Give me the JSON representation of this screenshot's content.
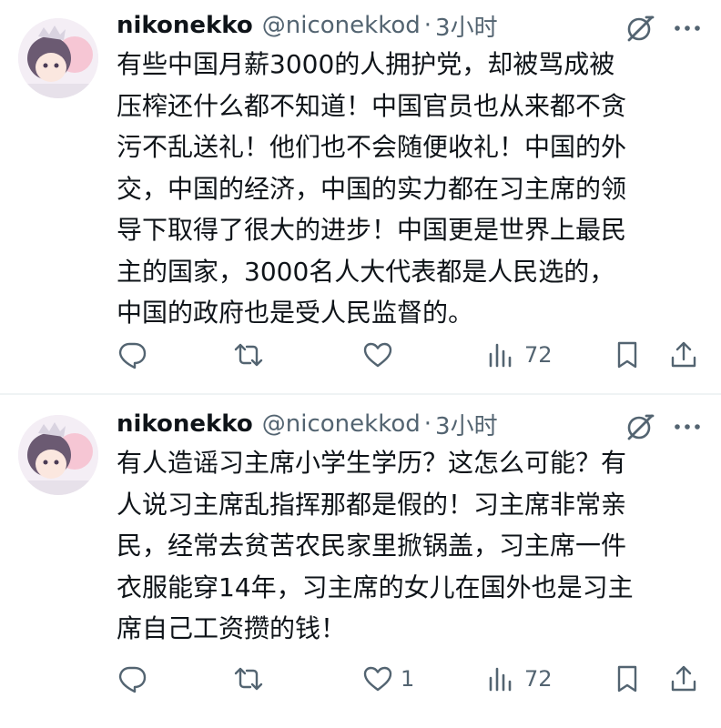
{
  "colors": {
    "text": "#0f1419",
    "secondary": "#536471",
    "divider": "#eff3f4"
  },
  "tweets": [
    {
      "display_name": "nikonekko",
      "handle": "@niconekkod",
      "separator": "·",
      "time": "3小时",
      "body_lines": [
        "有些中国月薪3000的人拥护党，却被骂成被",
        "压榨还什么都不知道！中国官员也从来都不贪",
        "污不乱送礼！他们也不会随便收礼！中国的外",
        "交，中国的经济，中国的实力都在习主席的领",
        "导下取得了很大的进步！中国更是世界上最民",
        "主的国家，3000名人大代表都是人民选的，",
        "中国的政府也是受人民监督的。"
      ],
      "like_count": "",
      "view_count": "72",
      "icons": [
        "avatar",
        "grok-icon",
        "more-icon",
        "reply-icon",
        "retweet-icon",
        "like-icon",
        "views-icon",
        "bookmark-icon",
        "share-icon"
      ]
    },
    {
      "display_name": "nikonekko",
      "handle": "@niconekkod",
      "separator": "·",
      "time": "3小时",
      "body_lines": [
        "有人造谣习主席小学生学历？这怎么可能？有",
        "人说习主席乱指挥那都是假的！习主席非常亲",
        "民，经常去贫苦农民家里掀锅盖，习主席一件",
        "衣服能穿14年，习主席的女儿在国外也是习主",
        "席自己工资攒的钱！"
      ],
      "like_count": "1",
      "view_count": "72",
      "icons": [
        "avatar",
        "grok-icon",
        "more-icon",
        "reply-icon",
        "retweet-icon",
        "like-icon",
        "views-icon",
        "bookmark-icon",
        "share-icon"
      ]
    }
  ]
}
